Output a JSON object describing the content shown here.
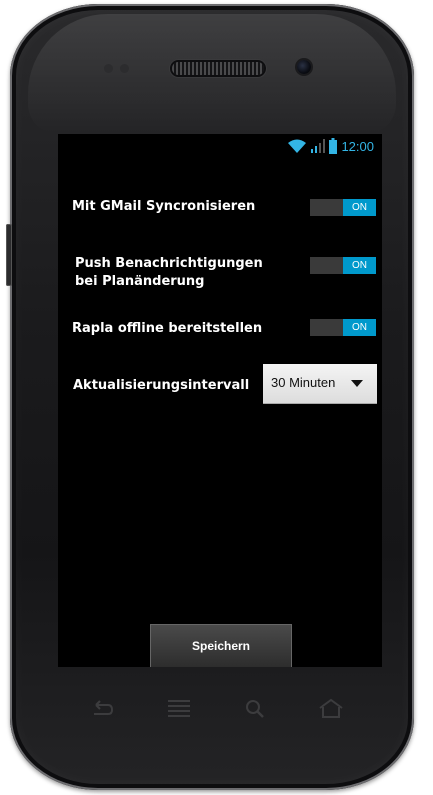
{
  "status_bar": {
    "time": "12:00",
    "icons": [
      "wifi-icon",
      "signal-icon",
      "battery-icon"
    ],
    "accent_color": "#33b5e5"
  },
  "settings": {
    "gmail_sync": {
      "label": "Mit GMail Syncronisieren",
      "state": "ON",
      "enabled": true
    },
    "push_notifications": {
      "label_line1": "Push Benachrichtigungen",
      "label_line2": "bei Planänderung",
      "state": "ON",
      "enabled": true
    },
    "offline": {
      "label": "Rapla offline bereitstellen",
      "state": "ON",
      "enabled": true
    },
    "update_interval": {
      "label": "Aktualisierungsintervall",
      "value": "30 Minuten"
    }
  },
  "save_button": {
    "label": "Speichern"
  },
  "nav_bar": {
    "icons": [
      "back-icon",
      "menu-icon",
      "search-icon",
      "home-icon"
    ]
  },
  "colors": {
    "toggle_on": "#0099cc",
    "toggle_off": "#3a3a3a",
    "screen_bg": "#000000"
  }
}
